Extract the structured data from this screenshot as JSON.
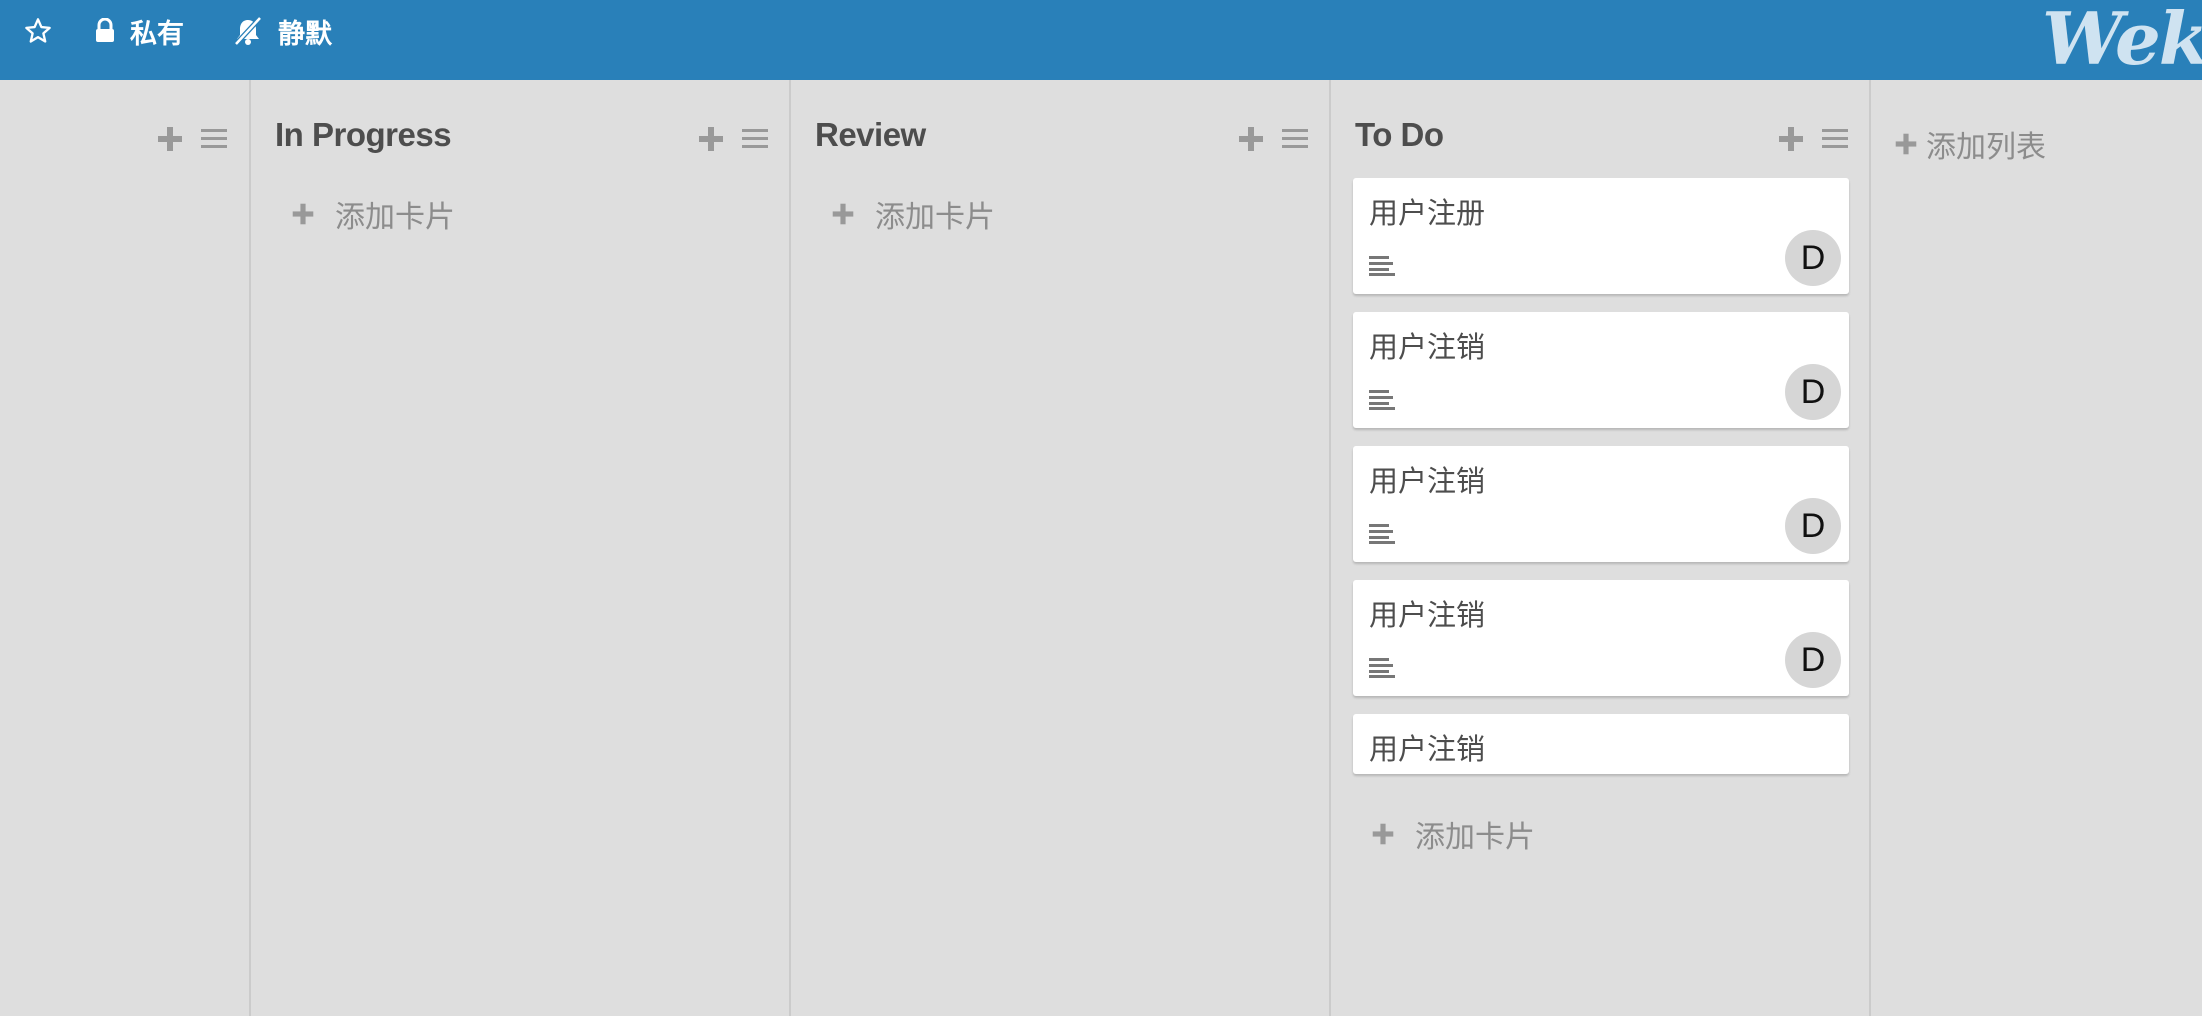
{
  "topbar": {
    "private_label": "私有",
    "mute_label": "静默",
    "logo_text": "Wekan"
  },
  "lists": [
    {
      "title": "",
      "add_card_label": ""
    },
    {
      "title": "In Progress",
      "add_card_label": "添加卡片"
    },
    {
      "title": "Review",
      "add_card_label": "添加卡片"
    },
    {
      "title": "To Do",
      "add_card_label": "添加卡片",
      "cards": [
        {
          "title": "用户注册",
          "avatar": "D"
        },
        {
          "title": "用户注销",
          "avatar": "D"
        },
        {
          "title": "用户注销",
          "avatar": "D"
        },
        {
          "title": "用户注销",
          "avatar": "D"
        },
        {
          "title": "用户注销"
        }
      ]
    }
  ],
  "add_list_label": "添加列表",
  "colors": {
    "header_bg": "#2980b9",
    "board_bg": "#dedede",
    "card_bg": "#ffffff",
    "muted_text": "#8c8c8c",
    "title_text": "#4d4d4d"
  }
}
